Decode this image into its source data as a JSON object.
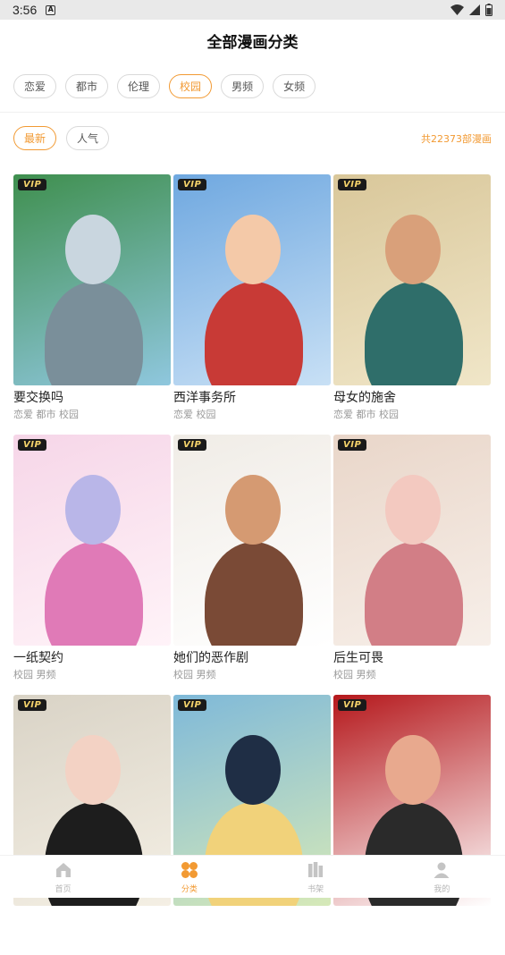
{
  "status_bar": {
    "time": "3:56"
  },
  "header": {
    "title": "全部漫画分类"
  },
  "categories": [
    {
      "label": "恋爱",
      "active": false
    },
    {
      "label": "都市",
      "active": false
    },
    {
      "label": "伦理",
      "active": false
    },
    {
      "label": "校园",
      "active": true
    },
    {
      "label": "男频",
      "active": false
    },
    {
      "label": "女频",
      "active": false
    }
  ],
  "sort": {
    "options": [
      {
        "label": "最新",
        "active": true
      },
      {
        "label": "人气",
        "active": false
      }
    ],
    "count_text": "共22373部漫画"
  },
  "badge_text": "VIP",
  "comics": [
    {
      "title": "要交换吗",
      "tags": "恋爱 都市 校园",
      "vip": true,
      "colors": [
        "#3f8f4e",
        "#8fc7de",
        "#7a8f9a",
        "#c9d6df"
      ]
    },
    {
      "title": "西洋事务所",
      "tags": "恋爱 校园",
      "vip": true,
      "colors": [
        "#6fa8e0",
        "#c8e0f5",
        "#c83a36",
        "#f4c9a8"
      ]
    },
    {
      "title": "母女的施舍",
      "tags": "恋爱 都市 校园",
      "vip": true,
      "colors": [
        "#d9c79a",
        "#f0e6c8",
        "#2f6e6a",
        "#d9a07a"
      ]
    },
    {
      "title": "一纸契约",
      "tags": "校园 男频",
      "vip": true,
      "colors": [
        "#f6d6e8",
        "#fff3f8",
        "#e07ab7",
        "#b9b6e8"
      ]
    },
    {
      "title": "她们的恶作剧",
      "tags": "校园 男频",
      "vip": true,
      "colors": [
        "#f0ece6",
        "#ffffff",
        "#7a4a36",
        "#d59a72"
      ]
    },
    {
      "title": "后生可畏",
      "tags": "校园 男频",
      "vip": true,
      "colors": [
        "#e9d6c9",
        "#f7efe9",
        "#d27e86",
        "#f3c9c0"
      ]
    },
    {
      "title": "",
      "tags": "",
      "vip": true,
      "colors": [
        "#d9d3c6",
        "#f4efe4",
        "#1d1d1d",
        "#f3d2c4"
      ]
    },
    {
      "title": "",
      "tags": "",
      "vip": true,
      "colors": [
        "#7fb9d9",
        "#d6e9b8",
        "#f1d27a",
        "#1f2e45"
      ]
    },
    {
      "title": "",
      "tags": "",
      "vip": true,
      "colors": [
        "#b5181c",
        "#ffffff",
        "#2a2a2a",
        "#e8a98e"
      ]
    }
  ],
  "tabbar": [
    {
      "label": "首页",
      "icon": "home-icon",
      "active": false
    },
    {
      "label": "分类",
      "icon": "category-icon",
      "active": true
    },
    {
      "label": "书架",
      "icon": "bookshelf-icon",
      "active": false
    },
    {
      "label": "我的",
      "icon": "profile-icon",
      "active": false
    }
  ]
}
